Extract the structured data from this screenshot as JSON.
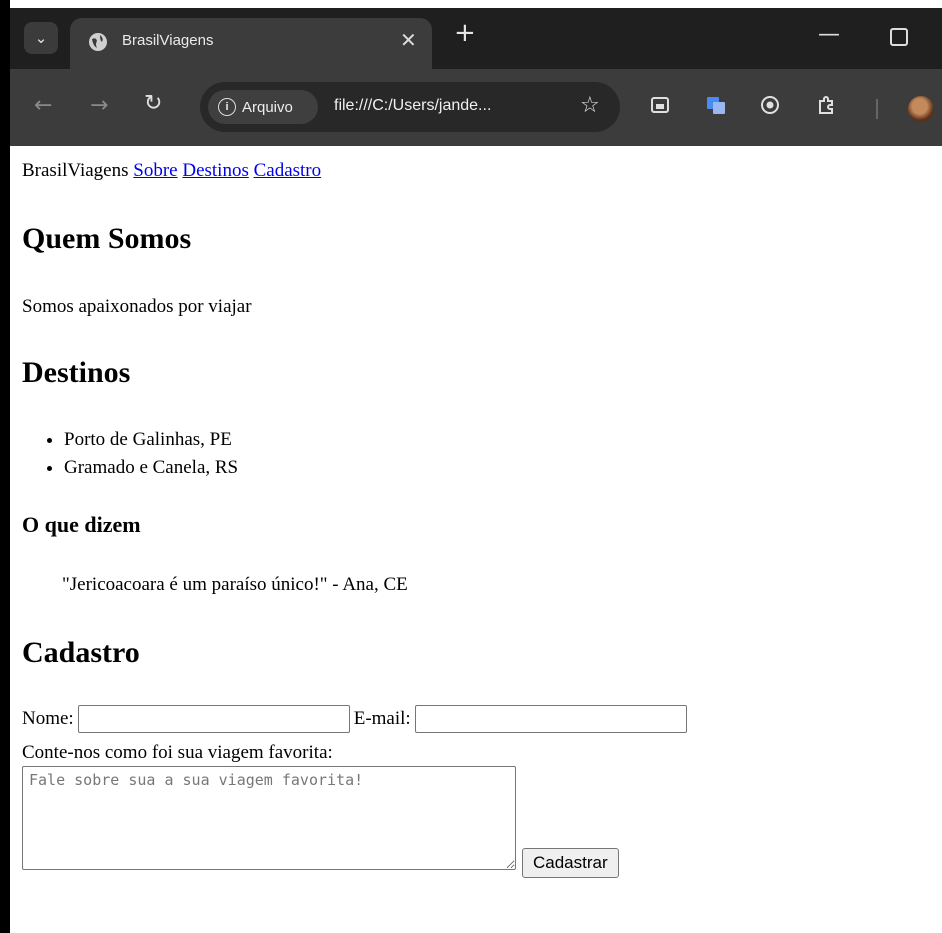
{
  "browser": {
    "tab_title": "BrasilViagens",
    "site_chip": "Arquivo",
    "url": "file:///C:/Users/jande..."
  },
  "page": {
    "brand": "BrasilViagens",
    "nav": [
      "Sobre",
      "Destinos",
      "Cadastro"
    ],
    "about": {
      "heading": "Quem Somos",
      "text": "Somos apaixonados por viajar"
    },
    "destinations": {
      "heading": "Destinos",
      "items": [
        "Porto de Galinhas, PE",
        "Gramado e Canela, RS"
      ]
    },
    "testimonials": {
      "heading": "O que dizem",
      "quote": "\"Jericoacoara é um paraíso único!\" - Ana, CE"
    },
    "signup": {
      "heading": "Cadastro",
      "name_label": "Nome:",
      "email_label": "E-mail:",
      "story_label": "Conte-nos como foi sua viagem favorita:",
      "story_placeholder": "Fale sobre sua a sua viagem favorita!",
      "submit_label": "Cadastrar"
    }
  }
}
